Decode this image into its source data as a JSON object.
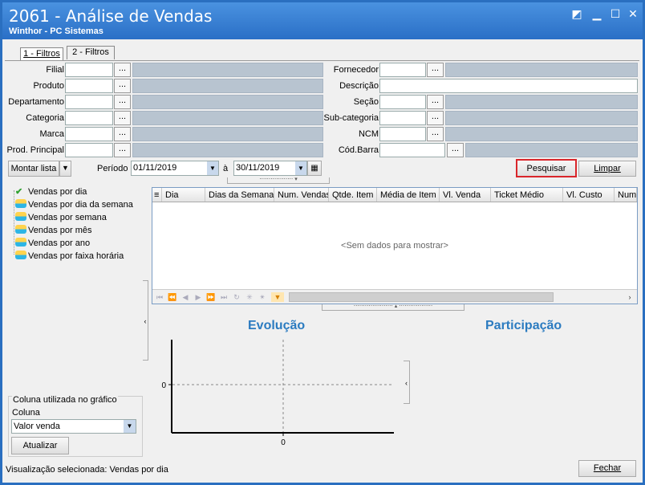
{
  "window": {
    "title": "2061 - Análise de Vendas",
    "subtitle": "Winthor - PC Sistemas"
  },
  "tabs": [
    {
      "label": "1 - Filtros",
      "active": true
    },
    {
      "label": "2 - Filtros",
      "active": false
    }
  ],
  "filters": {
    "left": [
      {
        "label": "Filial"
      },
      {
        "label": "Produto"
      },
      {
        "label": "Departamento"
      },
      {
        "label": "Categoria"
      },
      {
        "label": "Marca"
      },
      {
        "label": "Prod. Principal"
      }
    ],
    "right": [
      {
        "label": "Fornecedor"
      },
      {
        "label": "Descrição"
      },
      {
        "label": "Seção"
      },
      {
        "label": "Sub-categoria"
      },
      {
        "label": "NCM"
      },
      {
        "label": "Cód.Barra"
      }
    ],
    "dots": "..."
  },
  "toolbar": {
    "montar_lista": "Montar lista",
    "periodo_label": "Período",
    "date_from": "01/11/2019",
    "a_label": "à",
    "date_to": "30/11/2019",
    "pesquisar": "Pesquisar",
    "limpar": "Limpar"
  },
  "tree": {
    "items": [
      "Vendas por dia",
      "Vendas por dia da semana",
      "Vendas por semana",
      "Vendas por mês",
      "Vendas por ano",
      "Vendas por faixa horária"
    ]
  },
  "grid": {
    "columns": [
      "Dia",
      "Dias da Semana",
      "Num. Vendas",
      "Qtde. Item",
      "Média de Item",
      "Vl. Venda",
      "Ticket Médio",
      "Vl. Custo",
      "Num."
    ],
    "empty_text": "<Sem dados para mostrar>"
  },
  "charts": {
    "evolucao_title": "Evolução",
    "participacao_title": "Participação",
    "y_tick": "0",
    "x_tick": "0"
  },
  "chart_column": {
    "group_label": "Coluna utilizada no gráfico",
    "field_label": "Coluna",
    "selected": "Valor venda",
    "atualizar": "Atualizar"
  },
  "status": {
    "text": "Visualização selecionada: Vendas por dia",
    "fechar": "Fechar"
  },
  "colors": {
    "title_bar": "#2a6fc6",
    "accent_blue": "#2b7bc0",
    "highlight_red": "#d9262b"
  }
}
